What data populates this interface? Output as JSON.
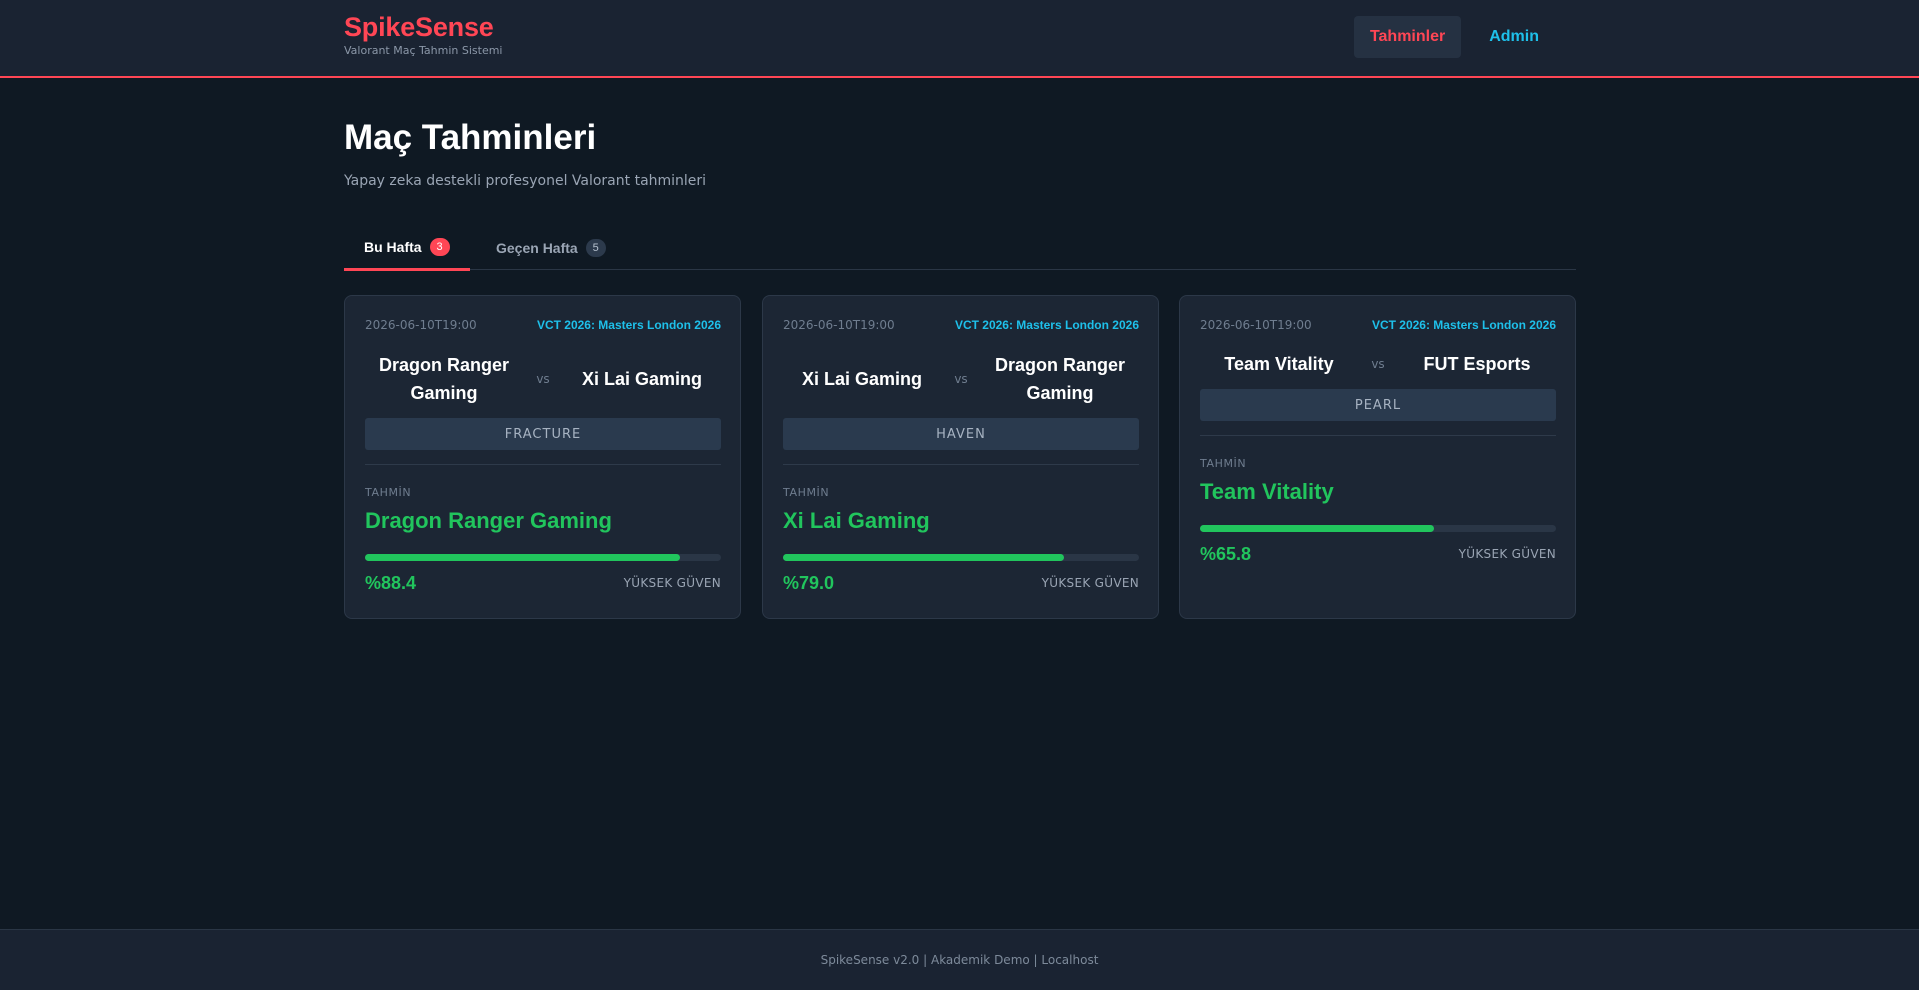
{
  "brand": {
    "title": "SpikeSense",
    "subtitle": "Valorant Maç Tahmin Sistemi"
  },
  "nav": {
    "predictions": "Tahminler",
    "admin": "Admin"
  },
  "page": {
    "title": "Maç Tahminleri",
    "subtitle": "Yapay zeka destekli profesyonel Valorant tahminleri"
  },
  "tabs": [
    {
      "label": "Bu Hafta",
      "count": "3"
    },
    {
      "label": "Geçen Hafta",
      "count": "5"
    }
  ],
  "cards": [
    {
      "date": "2026-06-10T19:00",
      "event": "VCT 2026: Masters London 2026",
      "team1": "Dragon Ranger Gaming",
      "vs": "vs",
      "team2": "Xi Lai Gaming",
      "map": "FRACTURE",
      "pred_label": "TAHMİN",
      "winner": "Dragon Ranger Gaming",
      "confidence": 88.4,
      "pct": "%88.4",
      "conf_label": "YÜKSEK GÜVEN"
    },
    {
      "date": "2026-06-10T19:00",
      "event": "VCT 2026: Masters London 2026",
      "team1": "Xi Lai Gaming",
      "vs": "vs",
      "team2": "Dragon Ranger Gaming",
      "map": "HAVEN",
      "pred_label": "TAHMİN",
      "winner": "Xi Lai Gaming",
      "confidence": 79.0,
      "pct": "%79.0",
      "conf_label": "YÜKSEK GÜVEN"
    },
    {
      "date": "2026-06-10T19:00",
      "event": "VCT 2026: Masters London 2026",
      "team1": "Team Vitality",
      "vs": "vs",
      "team2": "FUT Esports",
      "map": "PEARL",
      "pred_label": "TAHMİN",
      "winner": "Team Vitality",
      "confidence": 65.8,
      "pct": "%65.8",
      "conf_label": "YÜKSEK GÜVEN"
    }
  ],
  "footer": {
    "text": "SpikeSense v2.0 | Akademik Demo | Localhost"
  },
  "colors": {
    "accent": "#ff4655",
    "link": "#1ec0ea",
    "success": "#21c55d",
    "background": "#0f1923"
  }
}
